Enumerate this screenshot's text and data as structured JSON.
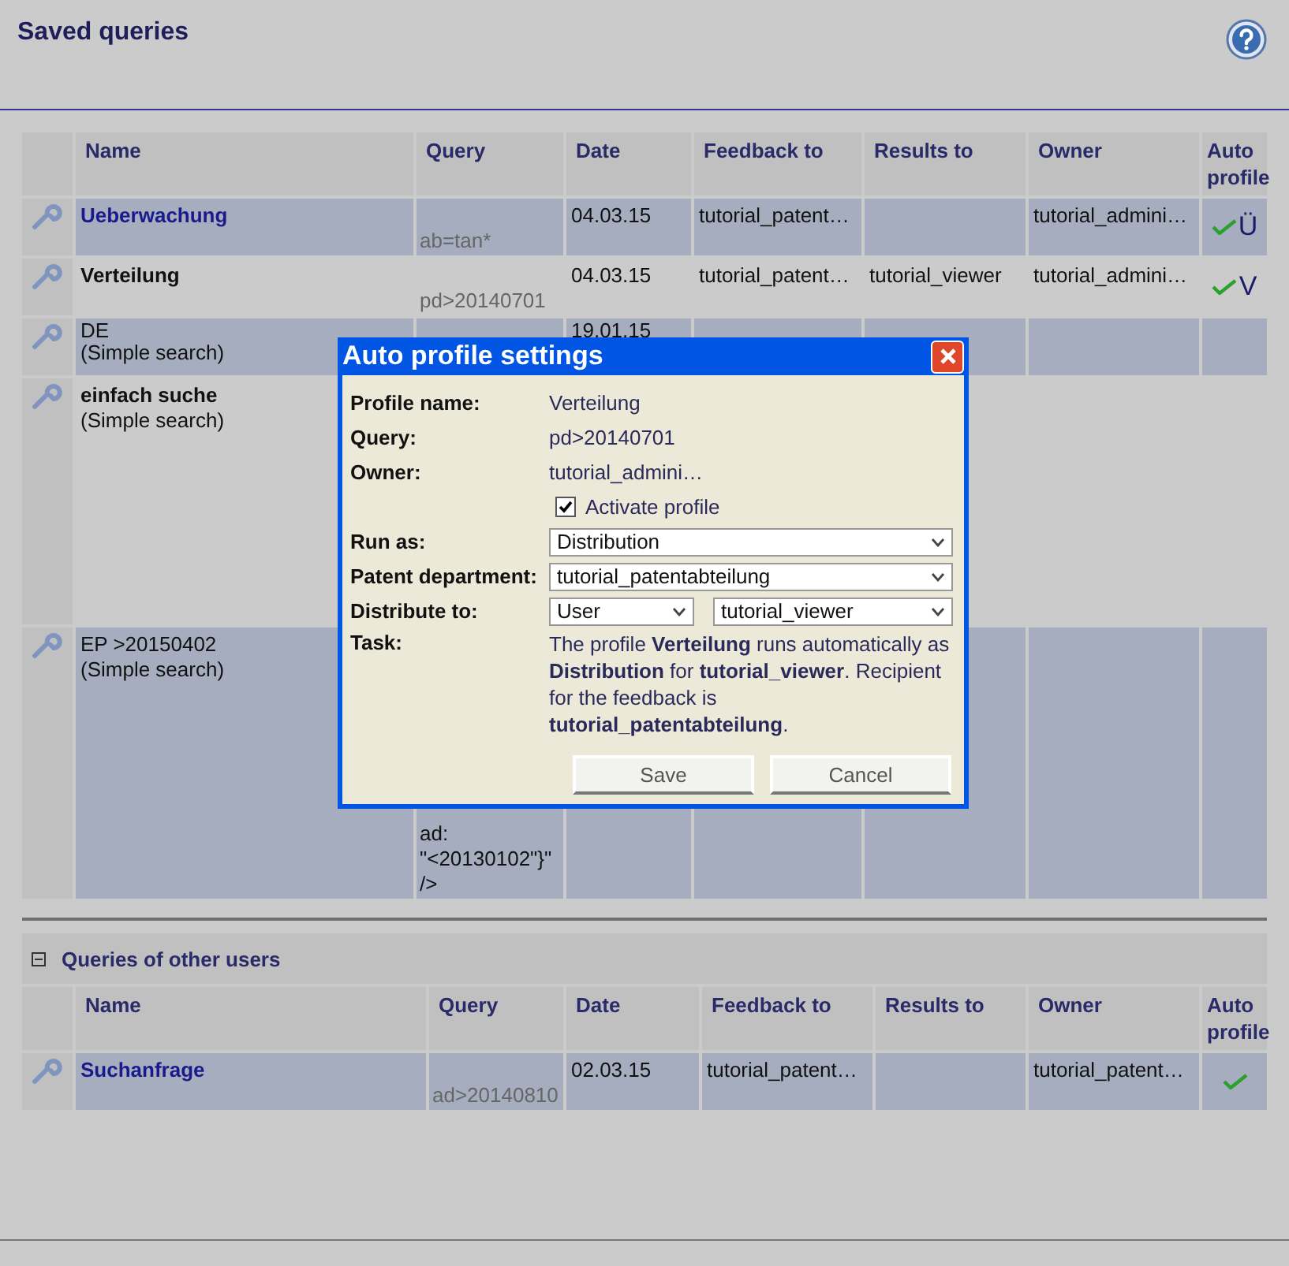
{
  "page": {
    "title": "Saved queries"
  },
  "columns": [
    "Name",
    "Query",
    "Date",
    "Feedback to",
    "Results to",
    "Owner",
    "Auto profile"
  ],
  "queries": [
    {
      "name": "Ueberwachung",
      "kind": "link",
      "query": "ab=tan*",
      "date": "04.03.15",
      "feedback_to": "tutorial_patent…",
      "owner": "tutorial_admini…",
      "auto_profile": true,
      "auto_letter": "Ü"
    },
    {
      "name": "Verteilung",
      "kind": "bold",
      "query": "pd>20140701",
      "date": "04.03.15",
      "feedback_to": "tutorial_patent…",
      "results_to": "tutorial_viewer",
      "owner": "tutorial_admini…",
      "auto_profile": true,
      "auto_letter": "V"
    },
    {
      "name": "DE",
      "kind": "plain",
      "subtitle": "(Simple search)",
      "date": "19.01.15",
      "auto_profile": false
    },
    {
      "name": "einfach suche",
      "kind": "bold",
      "subtitle": "(Simple search)",
      "auto_profile": false
    },
    {
      "name": "EP >20150402",
      "kind": "plain",
      "subtitle": "(Simple search)",
      "query": "ad:\n\"<20130102\"}\"\n/>",
      "auto_profile": false
    }
  ],
  "other_section": {
    "title": "Queries of other users",
    "expanded": true,
    "columns": [
      "Name",
      "Query",
      "Date",
      "Feedback to",
      "Results to",
      "Owner",
      "Auto profile"
    ],
    "queries": [
      {
        "name": "Suchanfrage",
        "kind": "link",
        "query": "ad>20140810",
        "date": "02.03.15",
        "feedback_to": "tutorial_patent…",
        "owner": "tutorial_patent…",
        "auto_profile": true
      }
    ]
  },
  "dialog": {
    "title": "Auto profile settings",
    "profile_name_label": "Profile name:",
    "profile_name": "Verteilung",
    "query_label": "Query:",
    "query": "pd>20140701",
    "owner_label": "Owner:",
    "owner": "tutorial_admini…",
    "activate": {
      "label": "Activate profile",
      "checked": true
    },
    "run_as_label": "Run as:",
    "run_as": "Distribution",
    "department_label": "Patent department:",
    "department": "tutorial_patentabteilung",
    "distribute_label": "Distribute to:",
    "distribute_type": "User",
    "distribute_target": "tutorial_viewer",
    "task_label": "Task:",
    "task": "The profile **Verteilung** runs automatically as **Distribution** for **tutorial_viewer**. Recipient for the feedback is **tutorial_patentabteilung**.",
    "buttons": [
      "Save",
      "Cancel"
    ]
  }
}
